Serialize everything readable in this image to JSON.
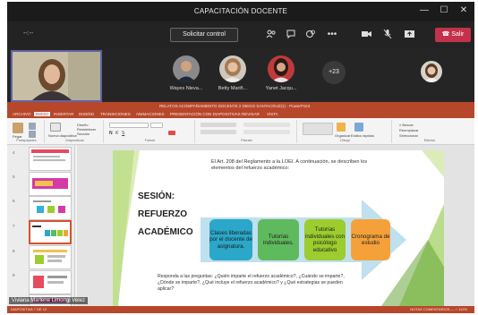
{
  "window": {
    "title": "CAPACITACIÓN DOCENTE"
  },
  "toolbar": {
    "timer": "--:--",
    "request_control_label": "Solicitar control",
    "leave_label": "Salir",
    "more_label": "•••"
  },
  "participants": [
    {
      "name": "Wayes Nieva..."
    },
    {
      "name": "Betty Mariñ..."
    },
    {
      "name": "Yanet Jacqu..."
    }
  ],
  "more_participants": "+23",
  "ppt": {
    "title": "RELATOS ACOMPAÑAMIENTO DOCENTE 2 DIEGO SANTACRUZ(1) - PowerPoint",
    "tabs": [
      "ARCHIVO",
      "INICIO",
      "INSERTAR",
      "DISEÑO",
      "TRANSICIONES",
      "ANIMACIONES",
      "PRESENTACIÓN CON DIAPOSITIVAS",
      "REVISAR",
      "VISTA"
    ],
    "ribbon_groups": [
      "Portapapeles",
      "Diapositivas",
      "Fuente",
      "Párrafo",
      "Dibujo",
      "Edición"
    ],
    "ribbon_items": {
      "paste": "Pegar",
      "new_slide": "Nueva diapositiva",
      "layout": "Diseño",
      "reset": "Restablecer",
      "section": "Sección",
      "arrange": "Organizar",
      "quick_styles": "Estilos rápidos",
      "search": "Buscar",
      "replace": "Reemplazar",
      "select": "Seleccionar"
    },
    "thumb_numbers": [
      "4",
      "5",
      "6",
      "7",
      "8",
      "9",
      "10"
    ],
    "status_left": "DIAPOSITIVA 7 DE 12",
    "status_right": "NOTAS  COMENTARIOS   —  + 112%"
  },
  "slide": {
    "intro": "El Art. 208 del Reglamento a la LOEI. A continuación, se describen los elementos del refuerzo académico:",
    "heading_lines": [
      "SESIÓN:",
      "REFUERZO",
      "ACADÉMICO"
    ],
    "boxes": [
      {
        "text": "Clases liberadas por el docente de asignatura.",
        "color": "#2aa7c9"
      },
      {
        "text": "Tutorías individuales.",
        "color": "#5fb95d"
      },
      {
        "text": "Tutorías individuales con psicólogo educativo",
        "color": "#9ccc2d"
      },
      {
        "text": "Cronograma de estudio",
        "color": "#f5a13a"
      }
    ],
    "question": "Responda a las preguntas: ¿Quién imparte el refuerzo académico?, ¿Cuándo se imparte?, ¿Dónde se imparte?, ¿Qué incluye el refuerzo académico? y ¿Qué estrategias se pueden aplicar?"
  },
  "speaker": {
    "name": "Viviana Marlene Limongi Velez"
  }
}
